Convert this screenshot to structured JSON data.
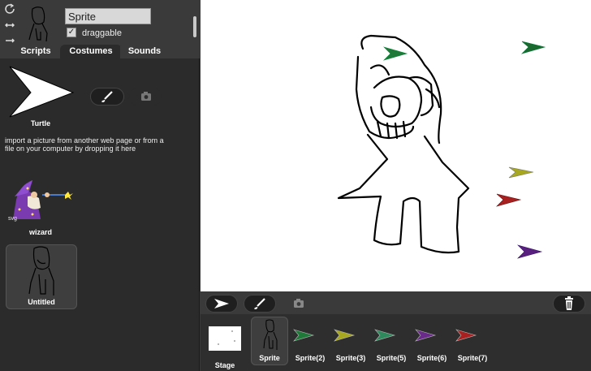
{
  "sprite": {
    "name_value": "Sprite",
    "draggable_label": "draggable",
    "draggable_checked": "✓"
  },
  "tabs": [
    {
      "label": "Scripts"
    },
    {
      "label": "Costumes"
    },
    {
      "label": "Sounds"
    }
  ],
  "costumes": {
    "turtle_label": "Turtle",
    "import_text": "import a picture from another web page or from a file on your computer by dropping it here",
    "items": [
      {
        "label": "wizard",
        "badge": "svg"
      },
      {
        "label": "Untitled"
      }
    ]
  },
  "corral": {
    "stage_label": "Stage",
    "sprites": [
      {
        "label": "Sprite",
        "color": "#000000"
      },
      {
        "label": "Sprite(2)",
        "color": "#1f7a3a"
      },
      {
        "label": "Sprite(3)",
        "color": "#a8a820"
      },
      {
        "label": "Sprite(5)",
        "color": "#2e8a5c"
      },
      {
        "label": "Sprite(6)",
        "color": "#6a2a8a"
      },
      {
        "label": "Sprite(7)",
        "color": "#a82020"
      }
    ]
  },
  "icons": {
    "rotate": "rotate-icon",
    "flip": "flip-icon",
    "no_rotate": "no-rotate-icon",
    "paint": "paintbrush-icon",
    "camera": "camera-icon",
    "turtle": "turtle-icon",
    "trash": "trash-icon"
  }
}
